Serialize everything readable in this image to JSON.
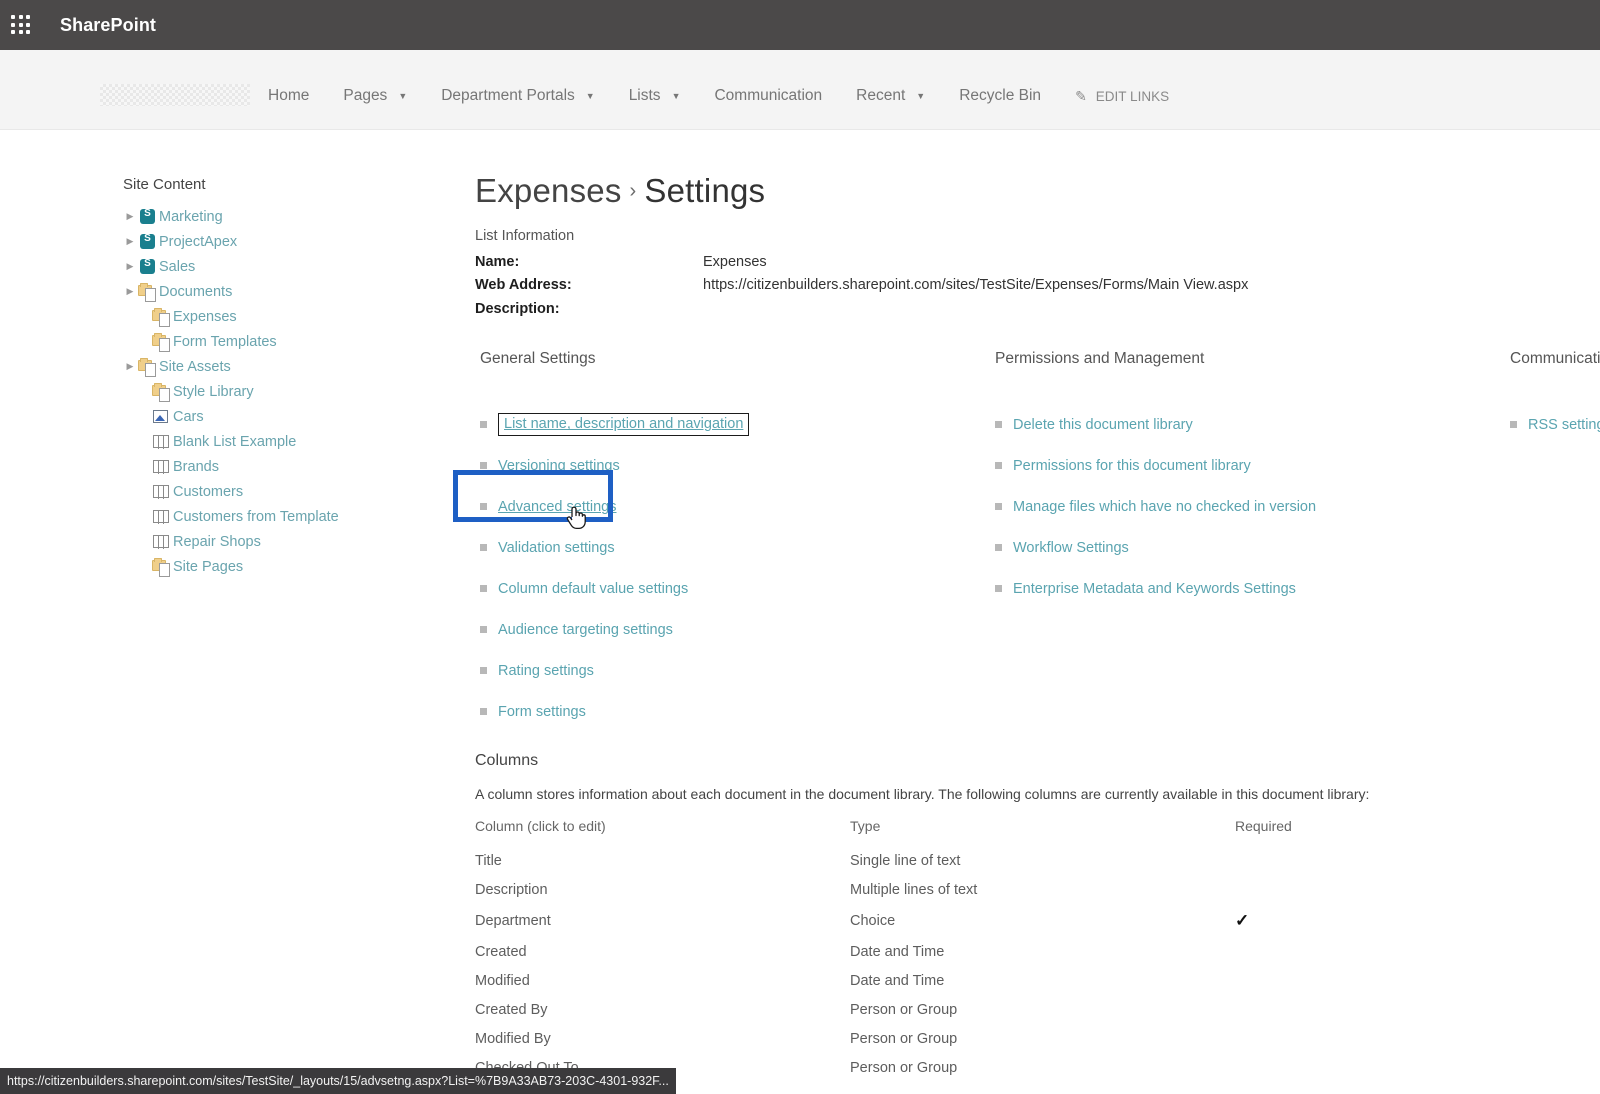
{
  "suite": {
    "app_launcher_icon": "waffle-grid-icon",
    "brand": "SharePoint"
  },
  "topnav": {
    "items": [
      {
        "label": "Home",
        "has_dropdown": false
      },
      {
        "label": "Pages",
        "has_dropdown": true
      },
      {
        "label": "Department Portals",
        "has_dropdown": true
      },
      {
        "label": "Lists",
        "has_dropdown": true
      },
      {
        "label": "Communication",
        "has_dropdown": false
      },
      {
        "label": "Recent",
        "has_dropdown": true
      },
      {
        "label": "Recycle Bin",
        "has_dropdown": false
      }
    ],
    "edit_links_label": "EDIT LINKS",
    "edit_links_icon": "pencil-icon"
  },
  "sidebar": {
    "title": "Site Content",
    "items": [
      {
        "label": "Marketing",
        "icon": "sharepoint-site-icon",
        "expandable": true,
        "indent": 1
      },
      {
        "label": "ProjectApex",
        "icon": "sharepoint-site-icon",
        "expandable": true,
        "indent": 1
      },
      {
        "label": "Sales",
        "icon": "sharepoint-site-icon",
        "expandable": true,
        "indent": 1
      },
      {
        "label": "Documents",
        "icon": "document-library-icon",
        "expandable": true,
        "indent": 1
      },
      {
        "label": "Expenses",
        "icon": "document-library-icon",
        "expandable": false,
        "indent": 2
      },
      {
        "label": "Form Templates",
        "icon": "document-library-icon",
        "expandable": false,
        "indent": 2
      },
      {
        "label": "Site Assets",
        "icon": "document-library-icon",
        "expandable": true,
        "indent": 1
      },
      {
        "label": "Style Library",
        "icon": "document-library-icon",
        "expandable": false,
        "indent": 2
      },
      {
        "label": "Cars",
        "icon": "picture-library-icon",
        "expandable": false,
        "indent": 2
      },
      {
        "label": "Blank List Example",
        "icon": "list-icon",
        "expandable": false,
        "indent": 2
      },
      {
        "label": "Brands",
        "icon": "list-icon",
        "expandable": false,
        "indent": 2
      },
      {
        "label": "Customers",
        "icon": "list-icon",
        "expandable": false,
        "indent": 2
      },
      {
        "label": "Customers from Template",
        "icon": "list-icon",
        "expandable": false,
        "indent": 2
      },
      {
        "label": "Repair Shops",
        "icon": "list-icon",
        "expandable": false,
        "indent": 2
      },
      {
        "label": "Site Pages",
        "icon": "document-library-icon",
        "expandable": false,
        "indent": 2
      }
    ]
  },
  "page": {
    "breadcrumb_list": "Expenses",
    "breadcrumb_separator": "›",
    "breadcrumb_page": "Settings",
    "list_information_label": "List Information",
    "info": [
      {
        "key": "Name:",
        "value": "Expenses"
      },
      {
        "key": "Web Address:",
        "value": "https://citizenbuilders.sharepoint.com/sites/TestSite/Expenses/Forms/Main View.aspx"
      },
      {
        "key": "Description:",
        "value": ""
      }
    ]
  },
  "settings": {
    "general": {
      "heading": "General Settings",
      "links": [
        {
          "label": "List name, description and navigation",
          "state": "focused"
        },
        {
          "label": "Versioning settings",
          "state": "normal"
        },
        {
          "label": "Advanced settings",
          "state": "highlighted"
        },
        {
          "label": "Validation settings",
          "state": "normal"
        },
        {
          "label": "Column default value settings",
          "state": "normal"
        },
        {
          "label": "Audience targeting settings",
          "state": "normal"
        },
        {
          "label": "Rating settings",
          "state": "normal"
        },
        {
          "label": "Form settings",
          "state": "normal"
        }
      ]
    },
    "permissions": {
      "heading": "Permissions and Management",
      "links": [
        {
          "label": "Delete this document library"
        },
        {
          "label": "Permissions for this document library"
        },
        {
          "label": "Manage files which have no checked in version"
        },
        {
          "label": "Workflow Settings"
        },
        {
          "label": "Enterprise Metadata and Keywords Settings"
        }
      ]
    },
    "communications": {
      "heading": "Communications",
      "links": [
        {
          "label": "RSS settings"
        }
      ]
    },
    "highlight_color": "#1e5fc4",
    "link_color": "#5aa4b0"
  },
  "columns_section": {
    "title": "Columns",
    "description": "A column stores information about each document in the document library. The following columns are currently available in this document library:",
    "headers": {
      "name": "Column (click to edit)",
      "type": "Type",
      "required": "Required"
    },
    "rows": [
      {
        "name": "Title",
        "type": "Single line of text",
        "required": ""
      },
      {
        "name": "Description",
        "type": "Multiple lines of text",
        "required": ""
      },
      {
        "name": "Department",
        "type": "Choice",
        "required": "✓"
      },
      {
        "name": "Created",
        "type": "Date and Time",
        "required": ""
      },
      {
        "name": "Modified",
        "type": "Date and Time",
        "required": ""
      },
      {
        "name": "Created By",
        "type": "Person or Group",
        "required": ""
      },
      {
        "name": "Modified By",
        "type": "Person or Group",
        "required": ""
      },
      {
        "name": "Checked Out To",
        "type": "Person or Group",
        "required": ""
      }
    ]
  },
  "statusbar": {
    "url": "https://citizenbuilders.sharepoint.com/sites/TestSite/_layouts/15/advsetng.aspx?List=%7B9A33AB73-203C-4301-932F..."
  }
}
